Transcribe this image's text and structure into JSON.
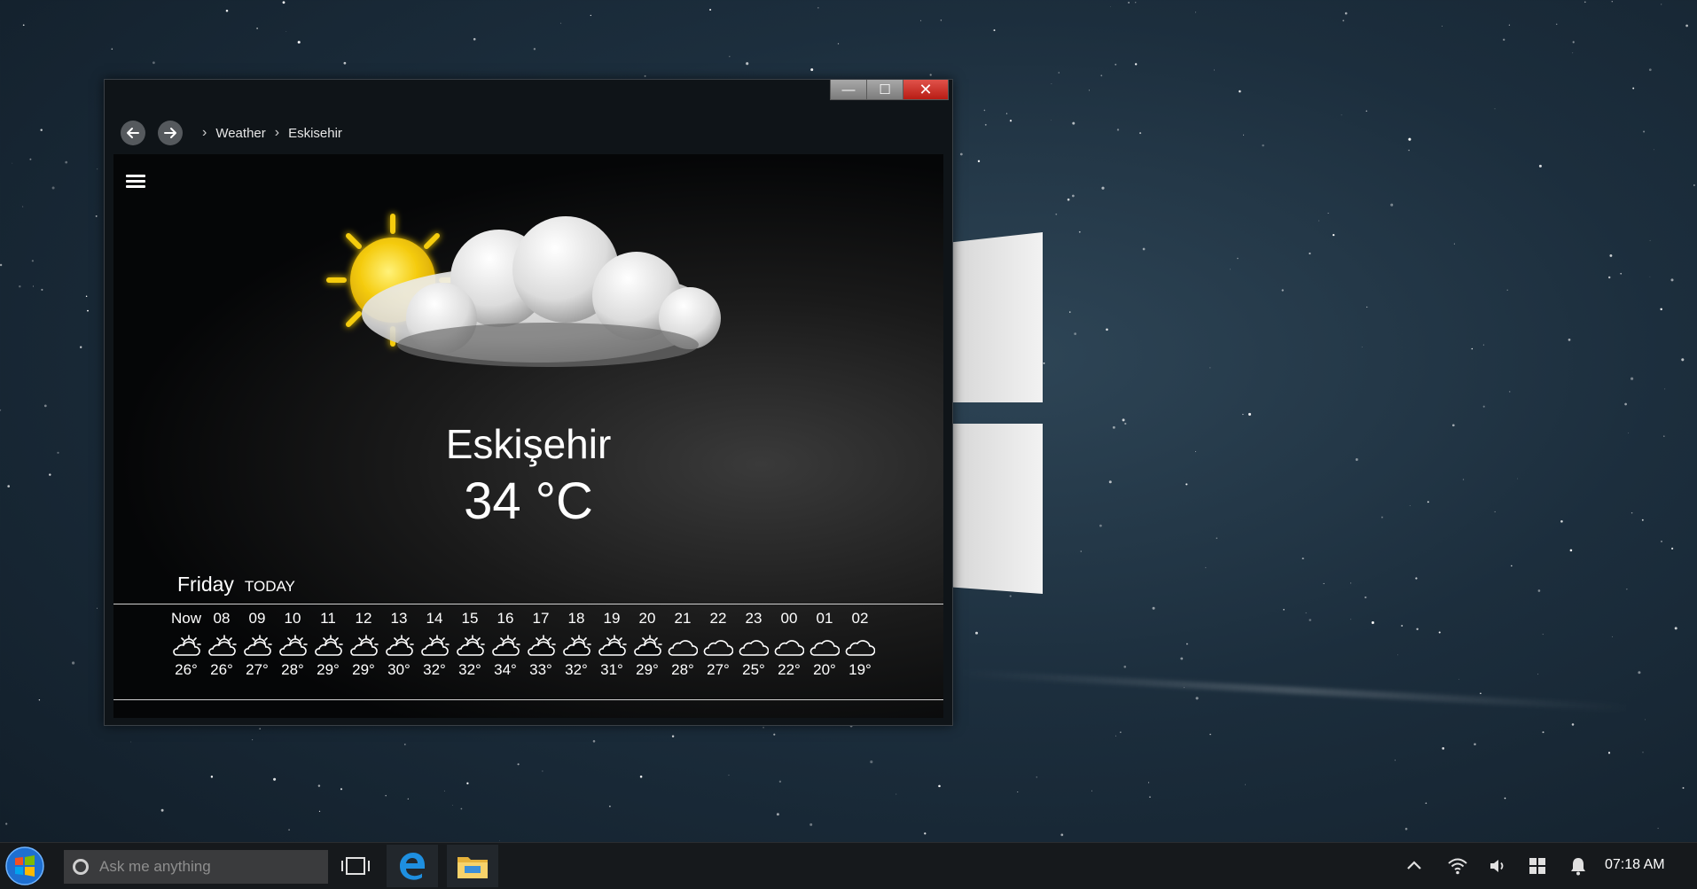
{
  "window": {
    "controls": {
      "minimize": "—",
      "maximize": "☐",
      "close": "✕"
    },
    "breadcrumb": [
      "Weather",
      "Eskisehir"
    ]
  },
  "weather": {
    "city": "Eskişehir",
    "temperature": "34 °C",
    "day": "Friday",
    "today_label": "TODAY",
    "hourly": [
      {
        "time": "Now",
        "icon": "partly-sunny-icon",
        "temp": "26°"
      },
      {
        "time": "08",
        "icon": "partly-sunny-icon",
        "temp": "26°"
      },
      {
        "time": "09",
        "icon": "partly-sunny-icon",
        "temp": "27°"
      },
      {
        "time": "10",
        "icon": "partly-sunny-icon",
        "temp": "28°"
      },
      {
        "time": "11",
        "icon": "partly-sunny-icon",
        "temp": "29°"
      },
      {
        "time": "12",
        "icon": "partly-sunny-icon",
        "temp": "29°"
      },
      {
        "time": "13",
        "icon": "partly-sunny-icon",
        "temp": "30°"
      },
      {
        "time": "14",
        "icon": "partly-sunny-icon",
        "temp": "32°"
      },
      {
        "time": "15",
        "icon": "partly-sunny-icon",
        "temp": "32°"
      },
      {
        "time": "16",
        "icon": "partly-sunny-icon",
        "temp": "34°"
      },
      {
        "time": "17",
        "icon": "partly-sunny-icon",
        "temp": "33°"
      },
      {
        "time": "18",
        "icon": "partly-sunny-icon",
        "temp": "32°"
      },
      {
        "time": "19",
        "icon": "partly-sunny-icon",
        "temp": "31°"
      },
      {
        "time": "20",
        "icon": "partly-sunny-icon",
        "temp": "29°"
      },
      {
        "time": "21",
        "icon": "cloud-icon",
        "temp": "28°"
      },
      {
        "time": "22",
        "icon": "cloud-icon",
        "temp": "27°"
      },
      {
        "time": "23",
        "icon": "cloud-icon",
        "temp": "25°"
      },
      {
        "time": "00",
        "icon": "cloud-icon",
        "temp": "22°"
      },
      {
        "time": "01",
        "icon": "cloud-icon",
        "temp": "20°"
      },
      {
        "time": "02",
        "icon": "cloud-icon",
        "temp": "19°"
      }
    ]
  },
  "taskbar": {
    "search_placeholder": "Ask me anything",
    "clock": "07:18 AM"
  },
  "colors": {
    "sun": "#f5cc10",
    "close_button": "#d0352c",
    "taskbar": "#16191c",
    "desktop": "#1c2e3d"
  }
}
